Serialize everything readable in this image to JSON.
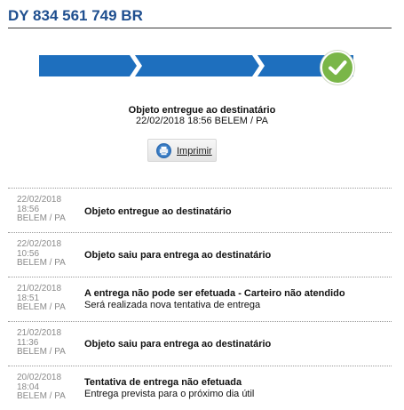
{
  "tracking": {
    "code": "DY 834 561 749 BR"
  },
  "progress": {
    "steps_completed": 3,
    "steps_total": 3,
    "colors": {
      "segment": "#1e6fbe",
      "check": "#7ab648"
    },
    "final_icon": "checkmark-icon"
  },
  "status": {
    "title": "Objeto entregue ao destinatário",
    "subtitle": "22/02/2018 18:56 BELEM / PA"
  },
  "print_button": {
    "label": "Imprimir",
    "icon": "printer-icon"
  },
  "events": [
    {
      "date": "22/02/2018",
      "time": "18:56",
      "place": "BELEM / PA",
      "title": "Objeto entregue ao destinatário",
      "detail": ""
    },
    {
      "date": "22/02/2018",
      "time": "10:56",
      "place": "BELEM / PA",
      "title": "Objeto saiu para entrega ao destinatário",
      "detail": ""
    },
    {
      "date": "21/02/2018",
      "time": "18:51",
      "place": "BELEM / PA",
      "title": "A entrega não pode ser efetuada - Carteiro não atendido",
      "detail": "Será realizada nova tentativa de entrega"
    },
    {
      "date": "21/02/2018",
      "time": "11:36",
      "place": "BELEM / PA",
      "title": "Objeto saiu para entrega ao destinatário",
      "detail": ""
    },
    {
      "date": "20/02/2018",
      "time": "18:04",
      "place": "BELEM / PA",
      "title": "Tentativa de entrega não efetuada",
      "detail": "Entrega prevista para o próximo dia útil"
    }
  ]
}
